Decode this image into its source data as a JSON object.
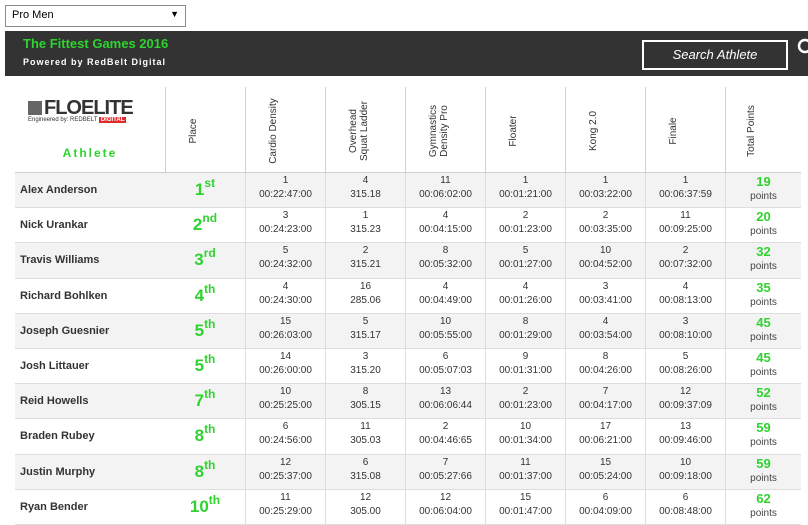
{
  "division_select": {
    "value": "Pro Men"
  },
  "banner": {
    "title": "The Fittest Games 2016",
    "subtitle": "Powered by RedBelt Digital",
    "search_label": "Search Athlete"
  },
  "logo": {
    "main": "FLOELITE",
    "engineered": "Engineered by: REDBELT",
    "digital": "DIGITAL"
  },
  "table": {
    "athlete_header": "Athlete",
    "headers": [
      "Place",
      "Cardio Density",
      "Overhead Squat Ladder",
      "Gymnastics Density Pro",
      "Floater",
      "Kong 2.0",
      "Finale",
      "Total Points"
    ],
    "points_label": "points",
    "rows": [
      {
        "name": "Alex Anderson",
        "place": "1",
        "suffix": "st",
        "events": [
          [
            "1",
            "00:22:47:00"
          ],
          [
            "4",
            "315.18"
          ],
          [
            "11",
            "00:06:02:00"
          ],
          [
            "1",
            "00:01:21:00"
          ],
          [
            "1",
            "00:03:22:00"
          ],
          [
            "1",
            "00:06:37:59"
          ]
        ],
        "points": "19"
      },
      {
        "name": "Nick Urankar",
        "place": "2",
        "suffix": "nd",
        "events": [
          [
            "3",
            "00:24:23:00"
          ],
          [
            "1",
            "315.23"
          ],
          [
            "4",
            "00:04:15:00"
          ],
          [
            "2",
            "00:01:23:00"
          ],
          [
            "2",
            "00:03:35:00"
          ],
          [
            "11",
            "00:09:25:00"
          ]
        ],
        "points": "20"
      },
      {
        "name": "Travis Williams",
        "place": "3",
        "suffix": "rd",
        "events": [
          [
            "5",
            "00:24:32:00"
          ],
          [
            "2",
            "315.21"
          ],
          [
            "8",
            "00:05:32:00"
          ],
          [
            "5",
            "00:01:27:00"
          ],
          [
            "10",
            "00:04:52:00"
          ],
          [
            "2",
            "00:07:32:00"
          ]
        ],
        "points": "32"
      },
      {
        "name": "Richard Bohlken",
        "place": "4",
        "suffix": "th",
        "events": [
          [
            "4",
            "00:24:30:00"
          ],
          [
            "16",
            "285.06"
          ],
          [
            "4",
            "00:04:49:00"
          ],
          [
            "4",
            "00:01:26:00"
          ],
          [
            "3",
            "00:03:41:00"
          ],
          [
            "4",
            "00:08:13:00"
          ]
        ],
        "points": "35"
      },
      {
        "name": "Joseph Guesnier",
        "place": "5",
        "suffix": "th",
        "events": [
          [
            "15",
            "00:26:03:00"
          ],
          [
            "5",
            "315.17"
          ],
          [
            "10",
            "00:05:55:00"
          ],
          [
            "8",
            "00:01:29:00"
          ],
          [
            "4",
            "00:03:54:00"
          ],
          [
            "3",
            "00:08:10:00"
          ]
        ],
        "points": "45"
      },
      {
        "name": "Josh Littauer",
        "place": "5",
        "suffix": "th",
        "events": [
          [
            "14",
            "00:26:00:00"
          ],
          [
            "3",
            "315.20"
          ],
          [
            "6",
            "00:05:07:03"
          ],
          [
            "9",
            "00:01:31:00"
          ],
          [
            "8",
            "00:04:26:00"
          ],
          [
            "5",
            "00:08:26:00"
          ]
        ],
        "points": "45"
      },
      {
        "name": "Reid Howells",
        "place": "7",
        "suffix": "th",
        "events": [
          [
            "10",
            "00:25:25:00"
          ],
          [
            "8",
            "305.15"
          ],
          [
            "13",
            "00:06:06:44"
          ],
          [
            "2",
            "00:01:23:00"
          ],
          [
            "7",
            "00:04:17:00"
          ],
          [
            "12",
            "00:09:37:09"
          ]
        ],
        "points": "52"
      },
      {
        "name": "Braden Rubey",
        "place": "8",
        "suffix": "th",
        "events": [
          [
            "6",
            "00:24:56:00"
          ],
          [
            "11",
            "305.03"
          ],
          [
            "2",
            "00:04:46:65"
          ],
          [
            "10",
            "00:01:34:00"
          ],
          [
            "17",
            "00:06:21:00"
          ],
          [
            "13",
            "00:09:46:00"
          ]
        ],
        "points": "59"
      },
      {
        "name": "Justin Murphy",
        "place": "8",
        "suffix": "th",
        "events": [
          [
            "12",
            "00:25:37:00"
          ],
          [
            "6",
            "315.08"
          ],
          [
            "7",
            "00:05:27:66"
          ],
          [
            "11",
            "00:01:37:00"
          ],
          [
            "15",
            "00:05:24:00"
          ],
          [
            "10",
            "00:09:18:00"
          ]
        ],
        "points": "59"
      },
      {
        "name": "Ryan Bender",
        "place": "10",
        "suffix": "th",
        "events": [
          [
            "11",
            "00:25:29:00"
          ],
          [
            "12",
            "305.00"
          ],
          [
            "12",
            "00:06:04:00"
          ],
          [
            "15",
            "00:01:47:00"
          ],
          [
            "6",
            "00:04:09:00"
          ],
          [
            "6",
            "00:08:48:00"
          ]
        ],
        "points": "62"
      }
    ]
  },
  "colors": {
    "accent_green": "#2fd32f",
    "banner_bg": "#333333",
    "logo_red": "#e02b2b"
  }
}
